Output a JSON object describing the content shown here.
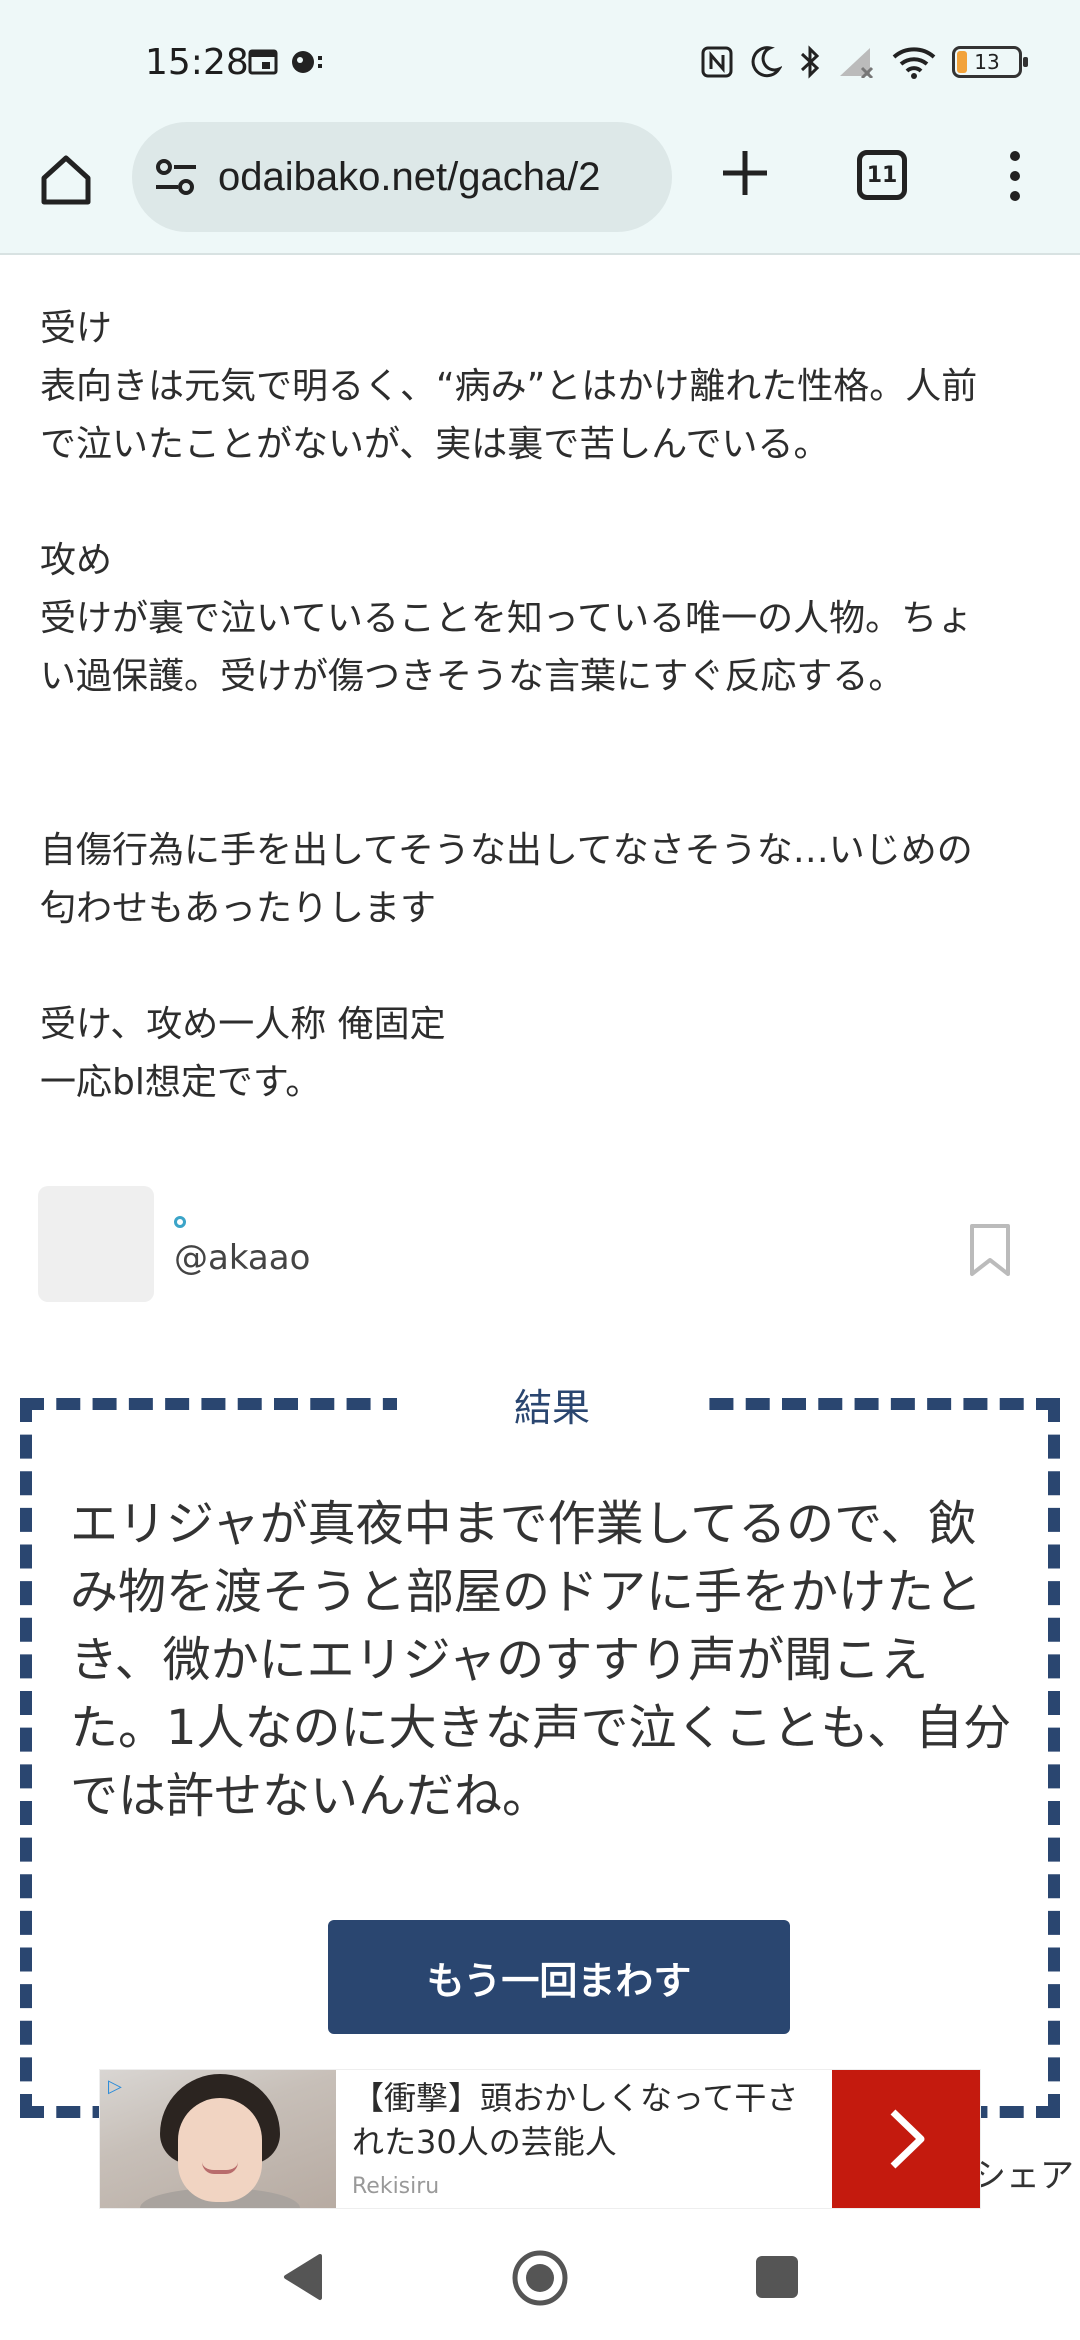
{
  "status_bar": {
    "time": "15:28",
    "battery_level": "13",
    "battery_color": "#f2a23a"
  },
  "browser": {
    "url": "odaibako.net/gacha/2",
    "tab_count": "11"
  },
  "description": {
    "uke_heading": "受け",
    "uke_line1": "表向きは元気で明るく、“病み”とはかけ離れた性格。人前",
    "uke_line2": "で泣いたことがないが、実は裏で苦しんでいる。",
    "seme_heading": "攻め",
    "seme_line1": "受けが裏で泣いていることを知っている唯一の人物。ちょ",
    "seme_line2": "い過保護。受けが傷つきそうな言葉にすぐ反応する。",
    "note_line1": "自傷行為に手を出してそうな出してなさそうな…いじめの",
    "note_line2": "匂わせもあったりします",
    "pronoun_line": "受け、攻め一人称 俺固定",
    "bl_line": "一応bl想定です。"
  },
  "author": {
    "name": "",
    "handle": "@akaao"
  },
  "result": {
    "title": "結果",
    "line1": "エリジャが真夜中まで作業してるので、飲",
    "line2": "み物を渡そうと部屋のドアに手をかけたと",
    "line3": "き、微かにエリジャのすすり声が聞こえ",
    "line4": "た。1人なのに大きな声で泣くことも、自分",
    "line5": "では許せないんだね。",
    "spin_again_label": "もう一回まわす"
  },
  "share_partial": "シェア",
  "ad": {
    "headline_line1": "【衝撃】頭おかしくなって干さ",
    "headline_line2": "れた30人の芸能人",
    "source": "Rekisiru",
    "arrow_color": "#c41a0e"
  },
  "colors": {
    "accent": "#2a4670",
    "toolbar_bg": "#eef8f8"
  }
}
